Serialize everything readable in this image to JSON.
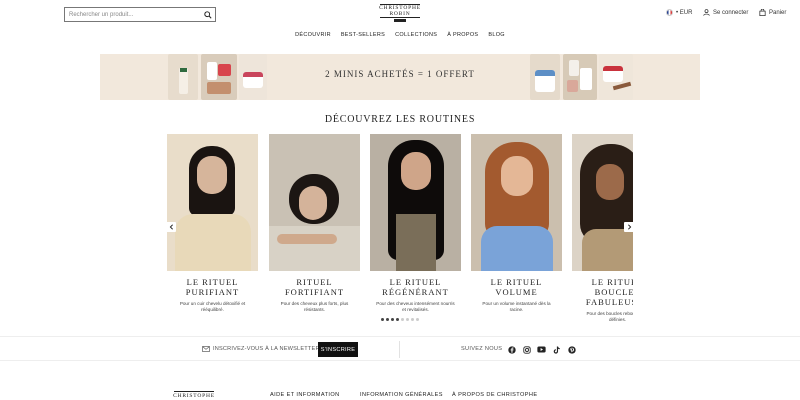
{
  "header": {
    "search_placeholder": "Rechercher un produit...",
    "logo_line1": "CHRISTOPHE",
    "logo_line2": "ROBIN",
    "currency": "• EUR",
    "login": "Se connecter",
    "cart": "Panier"
  },
  "nav": {
    "items": [
      "DÉCOUVRIR",
      "BEST-SELLERS",
      "COLLECTIONS",
      "À PROPOS",
      "BLOG"
    ]
  },
  "banner": {
    "text": "2 MINIS ACHETÉS = 1 OFFERT"
  },
  "routines": {
    "title": "DÉCOUVREZ LES ROUTINES",
    "cards": [
      {
        "title1": "LE RITUEL",
        "title2": "PURIFIANT",
        "desc": "Pour un cuir chevelu détoxifié et rééquilibré.",
        "bg": "#e9ddc9",
        "hair": "#1a1411",
        "top": "#e8d9b9"
      },
      {
        "title1": "RITUEL",
        "title2": "FORTIFIANT",
        "desc": "Pour des cheveux plus forts, plus résistants.",
        "bg": "#c9c1b4",
        "hair": "#1c1613",
        "top": "#d8d2c6"
      },
      {
        "title1": "LE RITUEL",
        "title2": "RÉGÉNÉRANT",
        "desc": "Pour des cheveux intensément nourris et revitalisés.",
        "bg": "#b9b0a3",
        "hair": "#0e0b0a",
        "top": "#7a6e59"
      },
      {
        "title1": "LE RITUEL",
        "title2": "VOLUME",
        "desc": "Pour un volume instantané dès la racine.",
        "bg": "#cbbfae",
        "hair": "#a35a2f",
        "top": "#7aa3d8"
      },
      {
        "title1": "LE RITUEL",
        "title2": "BOUCLES",
        "title3": "FABULEUSES",
        "desc": "Pour des boucles rebondies et définies.",
        "bg": "#dcd3c6",
        "hair": "#2a1e16",
        "top": "#b39a76"
      }
    ]
  },
  "pagination": {
    "total": 8,
    "active": 4
  },
  "newsletter": {
    "label": "INSCRIVEZ-VOUS À LA NEWSLETTER",
    "button": "S'INSCRIRE",
    "follow": "SUIVEZ NOUS"
  },
  "social_icons": [
    "facebook-icon",
    "instagram-icon",
    "youtube-icon",
    "tiktok-icon",
    "pinterest-icon"
  ],
  "footer": {
    "logo": "CHRISTOPHE",
    "col1": "AIDE ET INFORMATION",
    "col2": "INFORMATION GÉNÉRALES",
    "col3": "À PROPOS DE CHRISTOPHE"
  }
}
